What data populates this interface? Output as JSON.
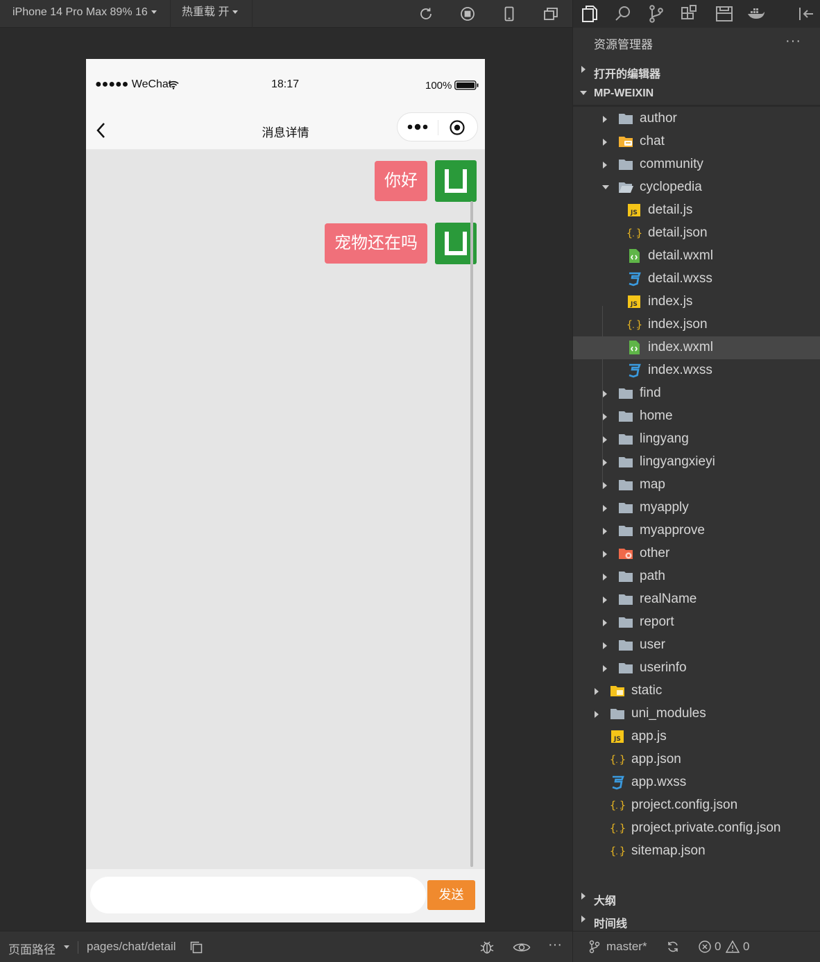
{
  "toolbar": {
    "device_select": "iPhone 14 Pro Max 89% 16",
    "hot_reload": "热重载 开"
  },
  "phone": {
    "status_bar": {
      "carrier": "●●●●● WeChat",
      "time": "18:17",
      "battery": "100%"
    },
    "nav": {
      "title": "消息详情"
    },
    "messages": [
      {
        "text": "你好"
      },
      {
        "text": "宠物还在吗"
      }
    ],
    "input": {
      "value": "",
      "placeholder": ""
    },
    "send_label": "发送"
  },
  "bottom_bar": {
    "page_path_label": "页面路径",
    "page_path": "pages/chat/detail"
  },
  "explorer": {
    "title": "资源管理器",
    "more": "···",
    "open_editors": "打开的编辑器",
    "project": "MP-WEIXIN",
    "tree": [
      {
        "name": "author",
        "type": "folder"
      },
      {
        "name": "chat",
        "type": "folder-chat"
      },
      {
        "name": "community",
        "type": "folder"
      },
      {
        "name": "cyclopedia",
        "type": "folder-open"
      },
      {
        "name": "detail.js",
        "type": "js"
      },
      {
        "name": "detail.json",
        "type": "json"
      },
      {
        "name": "detail.wxml",
        "type": "wxml"
      },
      {
        "name": "detail.wxss",
        "type": "wxss"
      },
      {
        "name": "index.js",
        "type": "js"
      },
      {
        "name": "index.json",
        "type": "json"
      },
      {
        "name": "index.wxml",
        "type": "wxml",
        "selected": true
      },
      {
        "name": "index.wxss",
        "type": "wxss"
      },
      {
        "name": "find",
        "type": "folder"
      },
      {
        "name": "home",
        "type": "folder"
      },
      {
        "name": "lingyang",
        "type": "folder"
      },
      {
        "name": "lingyangxieyi",
        "type": "folder"
      },
      {
        "name": "map",
        "type": "folder"
      },
      {
        "name": "myapply",
        "type": "folder"
      },
      {
        "name": "myapprove",
        "type": "folder"
      },
      {
        "name": "other",
        "type": "folder-other"
      },
      {
        "name": "path",
        "type": "folder"
      },
      {
        "name": "realName",
        "type": "folder"
      },
      {
        "name": "report",
        "type": "folder"
      },
      {
        "name": "user",
        "type": "folder"
      },
      {
        "name": "userinfo",
        "type": "folder"
      },
      {
        "name": "static",
        "type": "folder-static"
      },
      {
        "name": "uni_modules",
        "type": "folder"
      },
      {
        "name": "app.js",
        "type": "js"
      },
      {
        "name": "app.json",
        "type": "json"
      },
      {
        "name": "app.wxss",
        "type": "wxss"
      },
      {
        "name": "project.config.json",
        "type": "json"
      },
      {
        "name": "project.private.config.json",
        "type": "json"
      },
      {
        "name": "sitemap.json",
        "type": "json"
      }
    ],
    "outline": "大纲",
    "timeline": "时间线",
    "branch": "master*",
    "errors": "0",
    "warnings": "0"
  }
}
